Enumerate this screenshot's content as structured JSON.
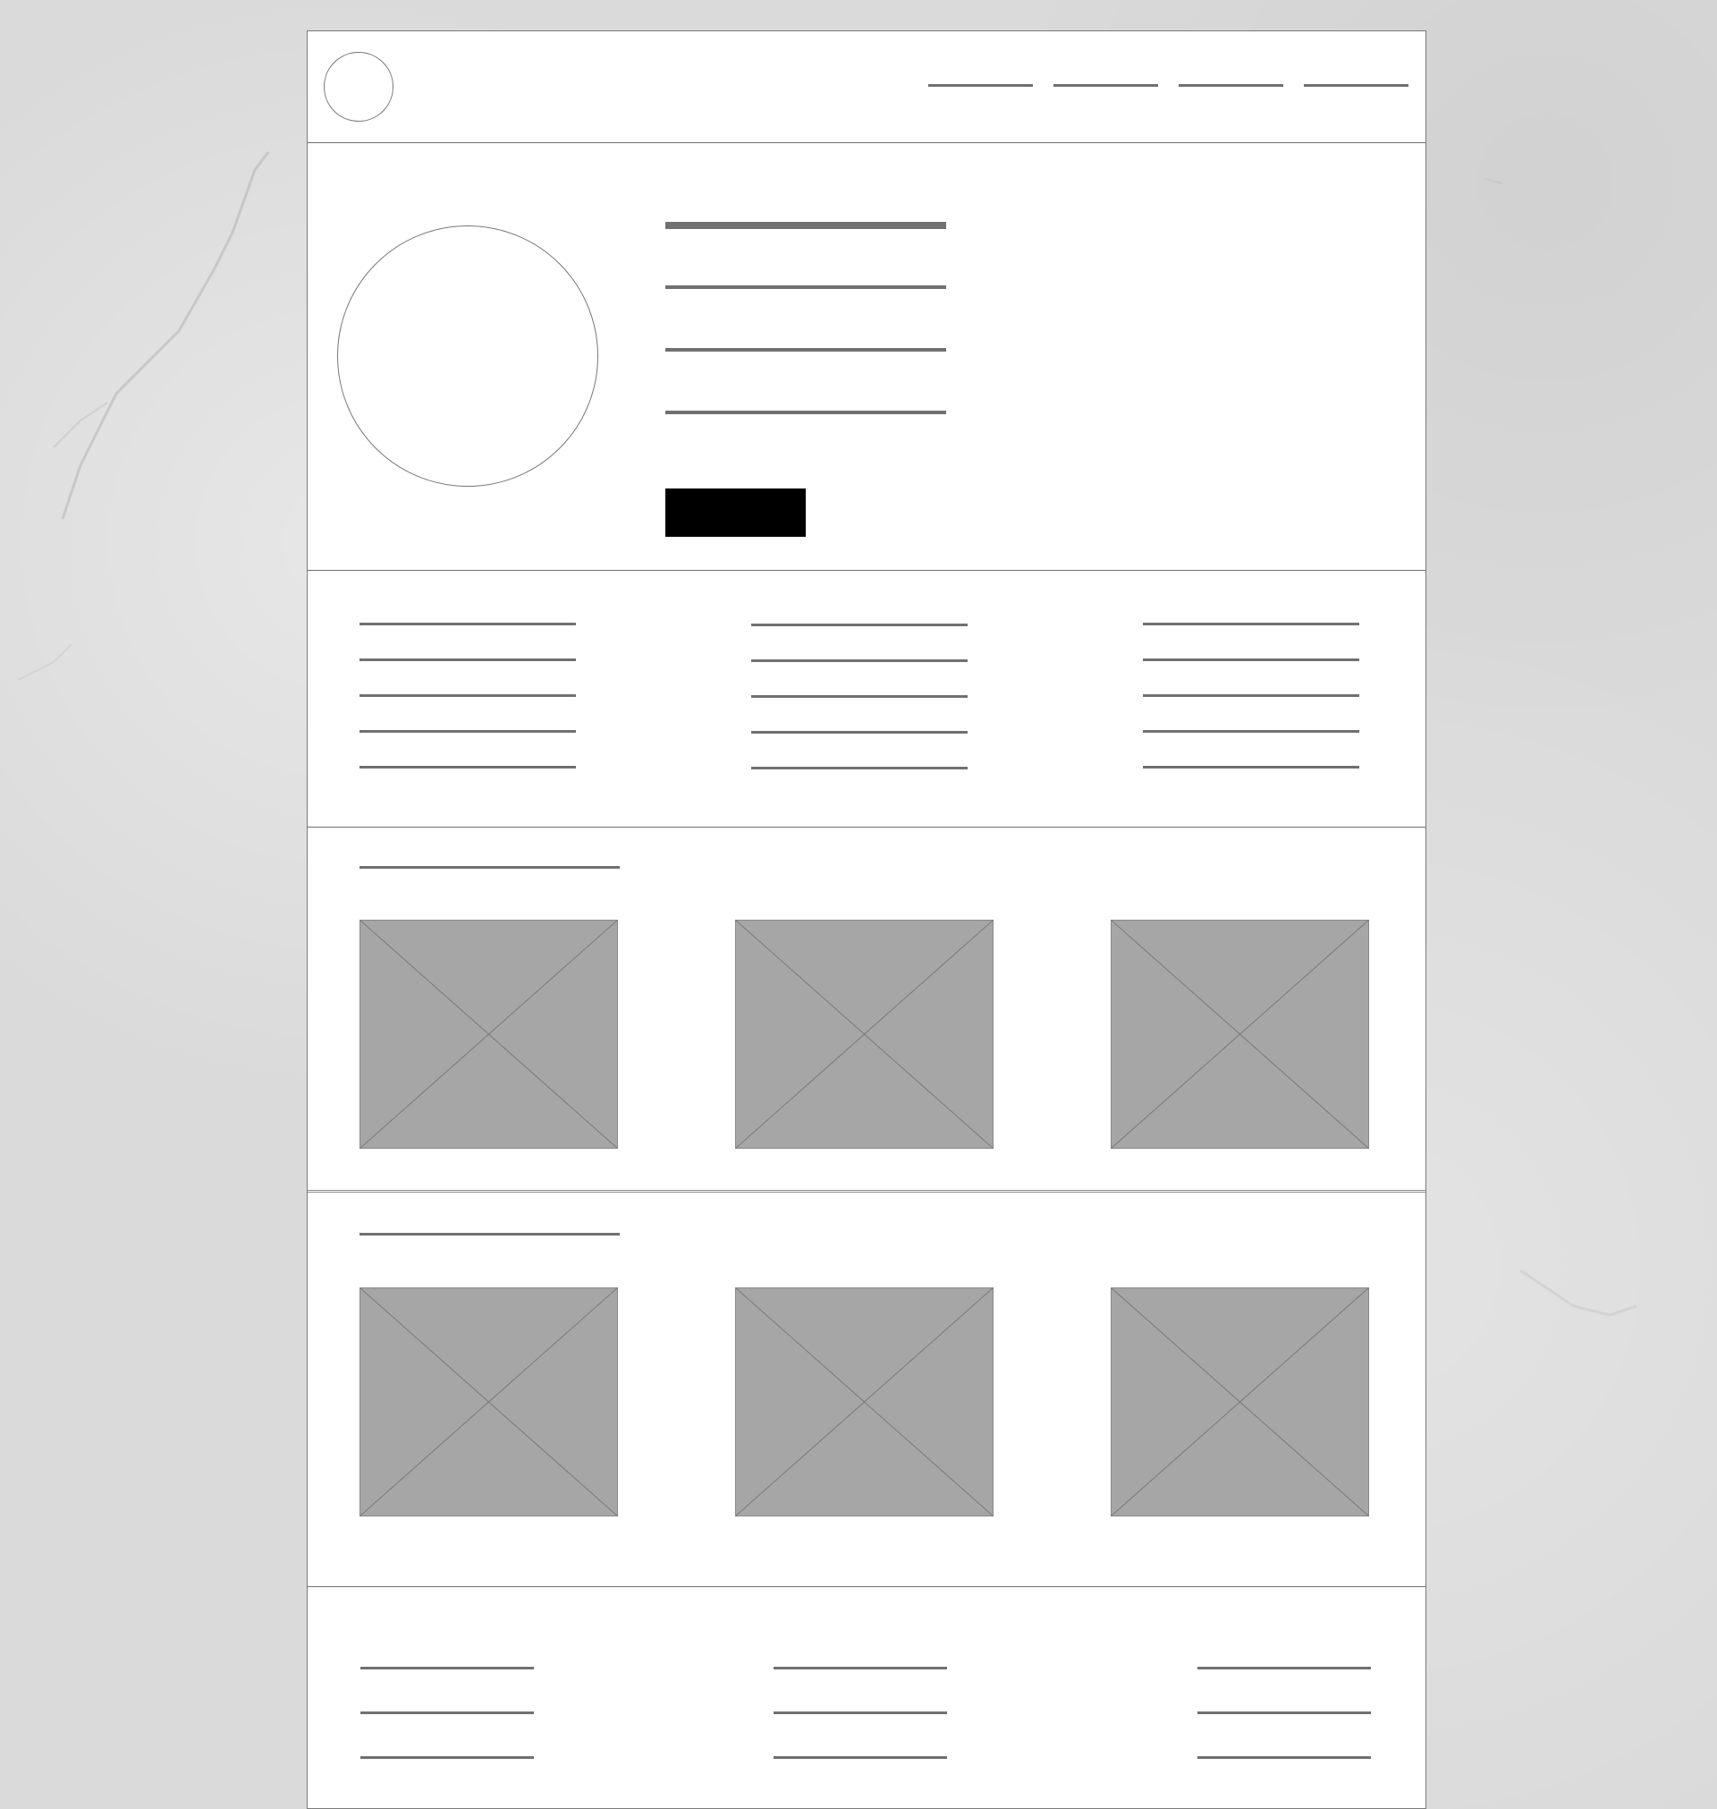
{
  "wireframe": {
    "background_color": "#dadada",
    "page_color": "#ffffff",
    "line_color": "#707070",
    "placeholder_fill": "#a6a6a6",
    "button_color": "#000000",
    "header": {
      "logo_icon": "circle-logo-icon",
      "nav_link_count": 4
    },
    "hero": {
      "avatar_icon": "circle-avatar-icon",
      "text_line_count": 4,
      "button_label": ""
    },
    "features": {
      "column_count": 3,
      "lines_per_column": 5
    },
    "gallery_one": {
      "title": "",
      "image_count": 3,
      "image_icon": "image-placeholder-icon"
    },
    "gallery_two": {
      "title": "",
      "image_count": 3,
      "image_icon": "image-placeholder-icon"
    },
    "footer": {
      "column_count": 3,
      "lines_per_column": 3
    }
  }
}
